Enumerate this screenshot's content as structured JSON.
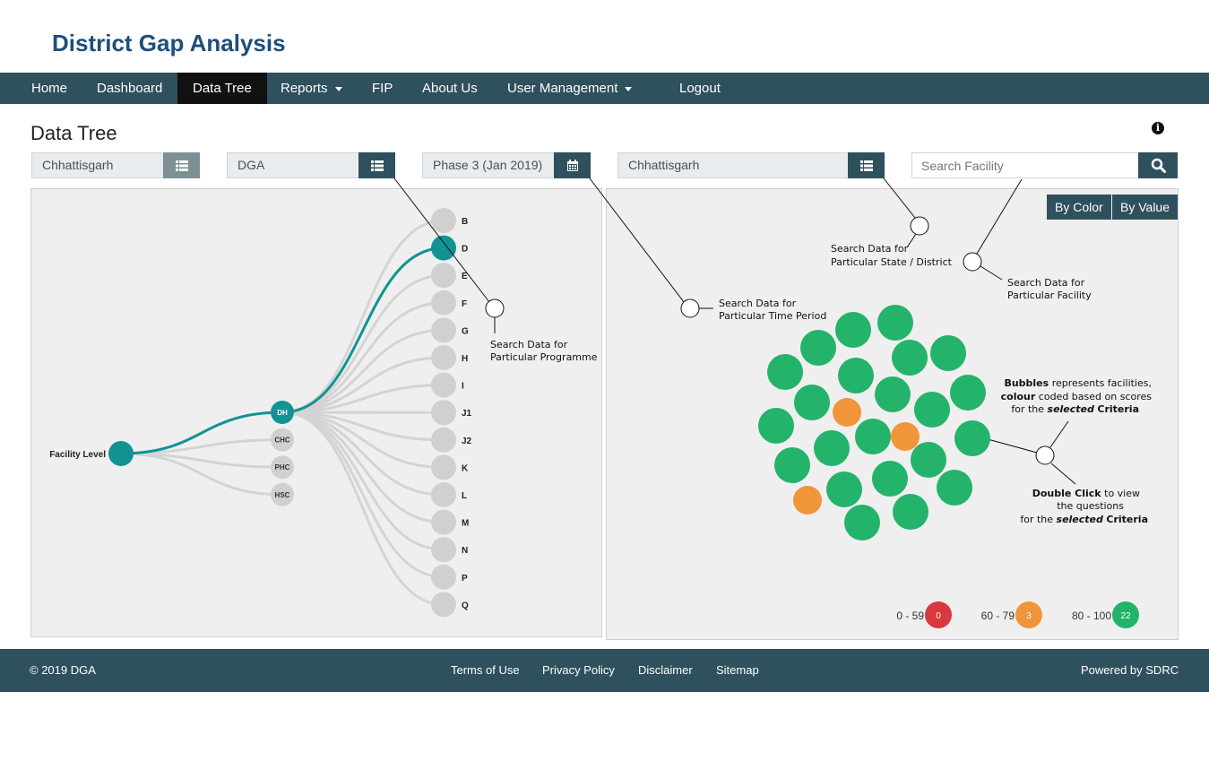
{
  "app_title": "District Gap Analysis",
  "nav": {
    "home": "Home",
    "dashboard": "Dashboard",
    "data_tree": "Data Tree",
    "reports": "Reports",
    "fip": "FIP",
    "about": "About Us",
    "user_management": "User Management",
    "logout": "Logout"
  },
  "page_title": "Data Tree",
  "filters": {
    "state": "Chhattisgarh",
    "programme": "DGA",
    "phase": "Phase 3 (Jan 2019)",
    "district": "Chhattisgarh",
    "search_placeholder": "Search Facility"
  },
  "tree": {
    "root": "Facility Level",
    "level2": [
      "DH",
      "CHC",
      "PHC",
      "HSC"
    ],
    "level3": [
      "B",
      "D",
      "E",
      "F",
      "G",
      "H",
      "I",
      "J1",
      "J2",
      "K",
      "L",
      "M",
      "N",
      "P",
      "Q"
    ],
    "selected_level2": "DH",
    "selected_level3": "D",
    "highlight_color": "#129393"
  },
  "toggles": {
    "by_color": "By Color",
    "by_value": "By Value"
  },
  "callouts": {
    "programme": [
      "Search Data for",
      "Particular Programme"
    ],
    "time": [
      "Search Data for",
      "Particular Time Period"
    ],
    "state": [
      "Search Data for",
      "Particular State / District"
    ],
    "facility": [
      "Search Data for",
      "Particular Facility"
    ],
    "bubbles_bold": "Bubbles",
    "bubbles_rest": "represents facilities,",
    "colour_bold": "colour",
    "colour_rest": "coded based on scores",
    "for_the": "for the",
    "selected_bold": "selected",
    "criteria_bold": "Criteria",
    "dblclick_bold": "Double Click",
    "dblclick_rest": "to view",
    "the_questions": "the questions"
  },
  "bubbles": {
    "green_color": "#24b36a",
    "orange_color": "#f0953a",
    "red_color": "#d9383f",
    "count_green": 22,
    "count_orange": 3,
    "count_red": 0
  },
  "legend": [
    {
      "label": "0 - 59",
      "count": "0",
      "color": "#d9383f"
    },
    {
      "label": "60 - 79",
      "count": "3",
      "color": "#f0953a"
    },
    {
      "label": "80 - 100",
      "count": "22",
      "color": "#24b36a"
    }
  ],
  "footer": {
    "copyright": "© 2019 DGA",
    "terms": "Terms of Use",
    "privacy": "Privacy Policy",
    "disclaimer": "Disclaimer",
    "sitemap": "Sitemap",
    "powered": "Powered by SDRC"
  }
}
